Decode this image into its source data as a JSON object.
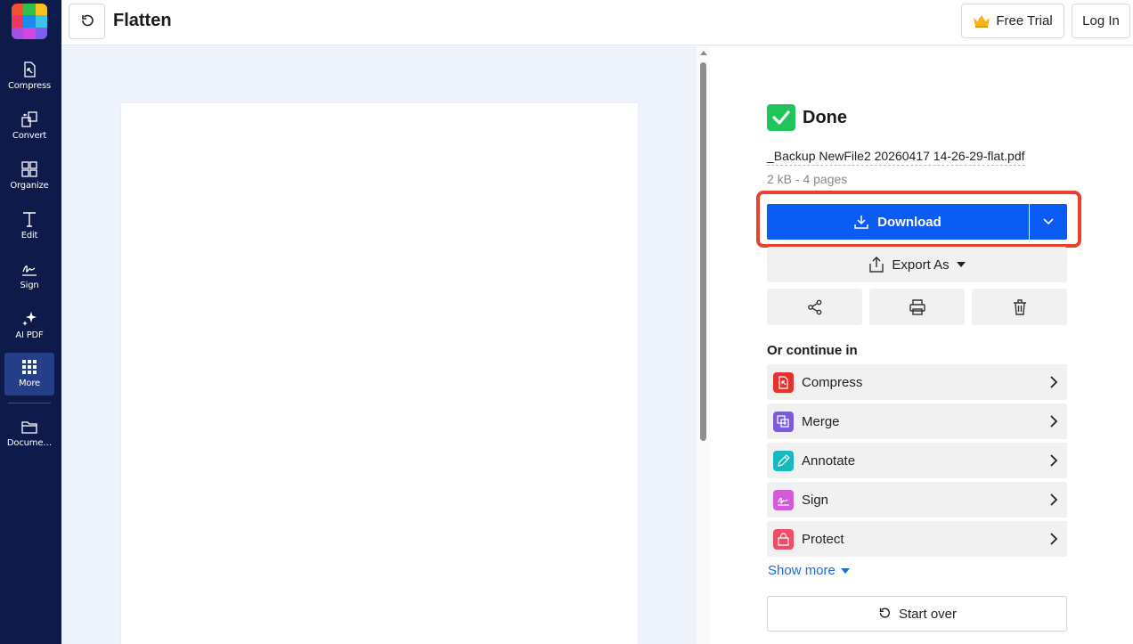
{
  "sidebar": {
    "items": [
      {
        "label": "Compress",
        "icon": "compress-icon"
      },
      {
        "label": "Convert",
        "icon": "convert-icon"
      },
      {
        "label": "Organize",
        "icon": "organize-icon"
      },
      {
        "label": "Edit",
        "icon": "edit-icon"
      },
      {
        "label": "Sign",
        "icon": "sign-icon"
      },
      {
        "label": "AI PDF",
        "icon": "ai-sparkle-icon"
      },
      {
        "label": "More",
        "icon": "grid-icon",
        "active": true
      },
      {
        "label": "Docume…",
        "icon": "folder-icon"
      }
    ],
    "colors": {
      "background": "#0e1a4a",
      "active": "#253e8a"
    }
  },
  "header": {
    "title": "Flatten",
    "free_trial_label": "Free Trial",
    "login_label": "Log In"
  },
  "result": {
    "status": "Done",
    "file_name": "_Backup NewFile2 20260417 14-26-29-flat.pdf",
    "file_meta": "2 kB - 4 pages",
    "download_label": "Download",
    "export_label": "Export As",
    "accent_color": "#0b5cf5",
    "highlight_color": "#e8412c"
  },
  "actions": [
    {
      "icon": "share-icon"
    },
    {
      "icon": "print-icon"
    },
    {
      "icon": "trash-icon"
    }
  ],
  "continue": {
    "title": "Or continue in",
    "items": [
      {
        "label": "Compress",
        "color": "#e5322d"
      },
      {
        "label": "Merge",
        "color": "#7b5cd6"
      },
      {
        "label": "Annotate",
        "color": "#18b8bf"
      },
      {
        "label": "Sign",
        "color": "#d35ad8"
      },
      {
        "label": "Protect",
        "color": "#ee4d6a"
      }
    ],
    "show_more_label": "Show more",
    "start_over_label": "Start over"
  }
}
